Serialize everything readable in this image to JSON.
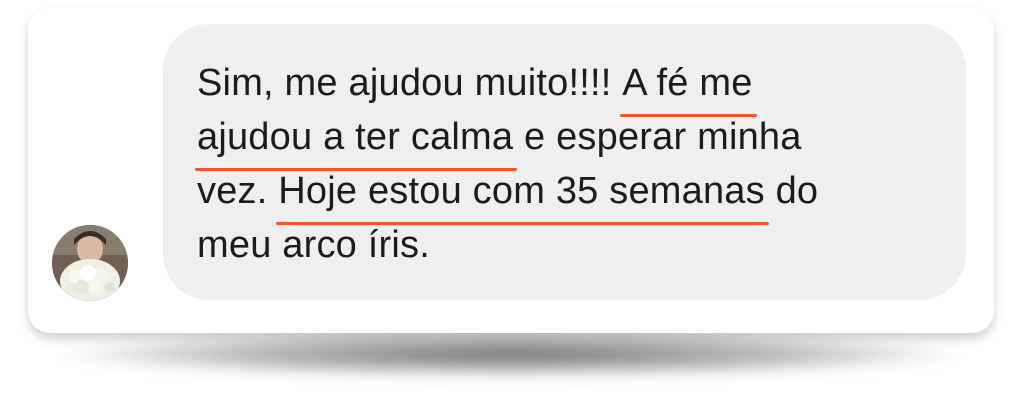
{
  "message": {
    "line1_a": "Sim, me ajudou muito!!!! ",
    "line1_hl": "A fé me",
    "line2_hl": "ajudou a ter calma",
    "line2_b": " e esperar minha",
    "line3_a": "vez. ",
    "line3_hl": "Hoje estou com 35 semanas",
    "line3_b": " do",
    "line4": "meu arco íris."
  },
  "colors": {
    "bubble_background": "#efefef",
    "text": "#1c1c1c",
    "highlight_underline": "#f0572a"
  },
  "icons": {
    "avatar": "profile-photo"
  }
}
